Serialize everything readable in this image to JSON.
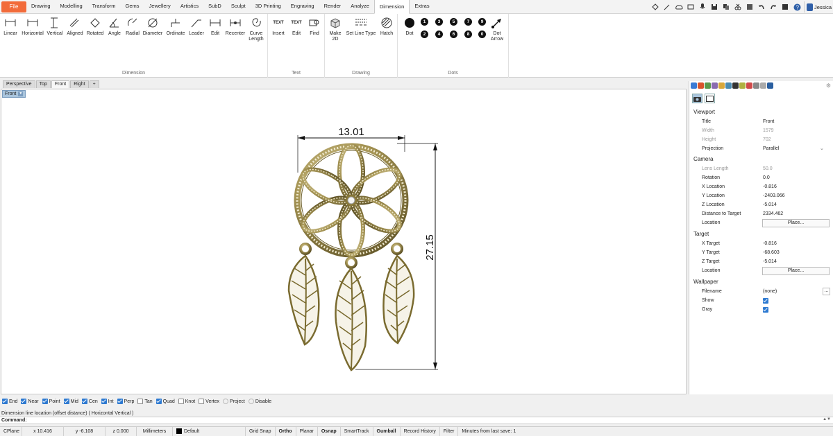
{
  "menu": {
    "file": "File",
    "tabs": [
      "Drawing",
      "Modelling",
      "Transform",
      "Gems",
      "Jewellery",
      "Artistics",
      "SubD",
      "Sculpt",
      "3D Printing",
      "Engraving",
      "Render",
      "Analyze",
      "Dimension",
      "Extras"
    ],
    "active_tab": "Dimension",
    "user": "Jessica"
  },
  "ribbon": {
    "dimension": {
      "label": "Dimension",
      "buttons": [
        "Linear",
        "Horizontal",
        "Vertical",
        "Aligned",
        "Rotated",
        "Angle",
        "Radial",
        "Diameter",
        "Ordinate",
        "Leader",
        "Edit",
        "Recenter",
        "Curve Length"
      ]
    },
    "text": {
      "label": "Text",
      "insert": "Insert",
      "edit": "Edit",
      "find": "Find",
      "insert_icon": "TEXT",
      "edit_icon": "TEXT"
    },
    "drawing": {
      "label": "Drawing",
      "make2d": "Make 2D",
      "set_line_type": "Set Line Type",
      "hatch": "Hatch"
    },
    "dots": {
      "label": "Dots",
      "dot": "Dot",
      "dot_arrow": "Dot Arrow",
      "numbers": [
        "1",
        "3",
        "5",
        "7",
        "9",
        "2",
        "4",
        "6",
        "8",
        "0"
      ]
    }
  },
  "viewport_tabs": [
    "Perspective",
    "Top",
    "Front",
    "Right"
  ],
  "active_viewport": "Front",
  "add_tab": "+",
  "viewport_title": "Front",
  "dimensions": {
    "width": "13.01",
    "height": "27.15"
  },
  "panel": {
    "viewport_section": "Viewport",
    "title_label": "Title",
    "title_value": "Front",
    "width_label": "Width",
    "width_value": "1579",
    "height_label": "Height",
    "height_value": "702",
    "projection_label": "Projection",
    "projection_value": "Parallel",
    "camera_section": "Camera",
    "lens_label": "Lens Length",
    "lens_value": "50.0",
    "rotation_label": "Rotation",
    "rotation_value": "0.0",
    "xloc_label": "X Location",
    "xloc_value": "-0.816",
    "yloc_label": "Y Location",
    "yloc_value": "-2403.066",
    "zloc_label": "Z Location",
    "zloc_value": "-5.014",
    "dist_label": "Distance to Target",
    "dist_value": "2334.462",
    "location_label": "Location",
    "place_label": "Place...",
    "target_section": "Target",
    "xt_label": "X Target",
    "xt_value": "-0.816",
    "yt_label": "Y Target",
    "yt_value": "-68.603",
    "zt_label": "Z Target",
    "zt_value": "-5.014",
    "tlocation_label": "Location",
    "tplace_label": "Place...",
    "wallpaper_section": "Wallpaper",
    "filename_label": "Filename",
    "filename_value": "(none)",
    "more": "...",
    "show_label": "Show",
    "gray_label": "Gray"
  },
  "osnaps": [
    {
      "label": "End",
      "checked": true
    },
    {
      "label": "Near",
      "checked": true
    },
    {
      "label": "Point",
      "checked": true
    },
    {
      "label": "Mid",
      "checked": true
    },
    {
      "label": "Cen",
      "checked": true
    },
    {
      "label": "Int",
      "checked": true
    },
    {
      "label": "Perp",
      "checked": true
    },
    {
      "label": "Tan",
      "checked": false
    },
    {
      "label": "Quad",
      "checked": true
    },
    {
      "label": "Knot",
      "checked": false
    },
    {
      "label": "Vertex",
      "checked": false
    },
    {
      "label": "Project",
      "checked": false
    },
    {
      "label": "Disable",
      "checked": false
    }
  ],
  "command": {
    "history": "Dimension line location (offset distance) ( Horizontal  Vertical )",
    "prompt": "Command:"
  },
  "status": {
    "cplane": "CPlane",
    "x": "x 10.416",
    "y": "y -6.108",
    "z": "z 0.000",
    "units": "Millimeters",
    "layer": "Default",
    "grid_snap": "Grid Snap",
    "ortho": "Ortho",
    "planar": "Planar",
    "osnap": "Osnap",
    "smarttrack": "SmartTrack",
    "gumball": "Gumball",
    "record_history": "Record History",
    "filter": "Filter",
    "last_save": "Minutes from last save: 1"
  },
  "colors": {
    "file_tab": "#f26b3a",
    "accent": "#2e7ad1",
    "gold": "#8a7a3a",
    "title_tab": "#a9c4dc"
  }
}
